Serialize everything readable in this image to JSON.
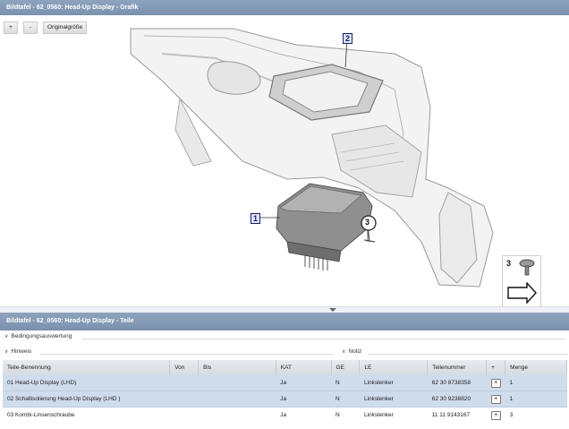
{
  "top_panel": {
    "title": "Bildtafel - 62_0560: Head-Up Display - Grafik",
    "toolbar": {
      "zoom_in": "+",
      "zoom_out": "-",
      "original_size": "Originalgröße"
    },
    "callouts": [
      "1",
      "2",
      "3"
    ],
    "legend_number": "3"
  },
  "bottom_panel": {
    "title": "Bildtafel - 62_0560: Head-Up Display - Teile",
    "sections": {
      "conditions": "Bedingungsauswertung",
      "hint": "Hinweis",
      "note": "Notiz"
    },
    "columns": [
      "Teile-Benennung",
      "Von",
      "Bis",
      "KAT",
      "GE",
      "LE",
      "Teilenummer",
      "+",
      "Menge"
    ],
    "rows": [
      {
        "name": "01 Head-Up Display (LHD)",
        "von": "",
        "bis": "",
        "kat": "Ja",
        "ge": "N",
        "le": "Linkslenker",
        "part_no": "62 30 8738358",
        "plus": "+",
        "qty": "1",
        "selected": true
      },
      {
        "name": "02 Schallisolierung Head-Up Display (LHD )",
        "von": "",
        "bis": "",
        "kat": "Ja",
        "ge": "N",
        "le": "Linkslenker",
        "part_no": "62 30 9238820",
        "plus": "+",
        "qty": "1",
        "selected": true
      },
      {
        "name": "03 Kombi-Linsenschraube",
        "von": "",
        "bis": "",
        "kat": "Ja",
        "ge": "N",
        "le": "Linkslenker",
        "part_no": "11 11 9143167",
        "plus": "+",
        "qty": "3",
        "selected": false
      }
    ]
  }
}
